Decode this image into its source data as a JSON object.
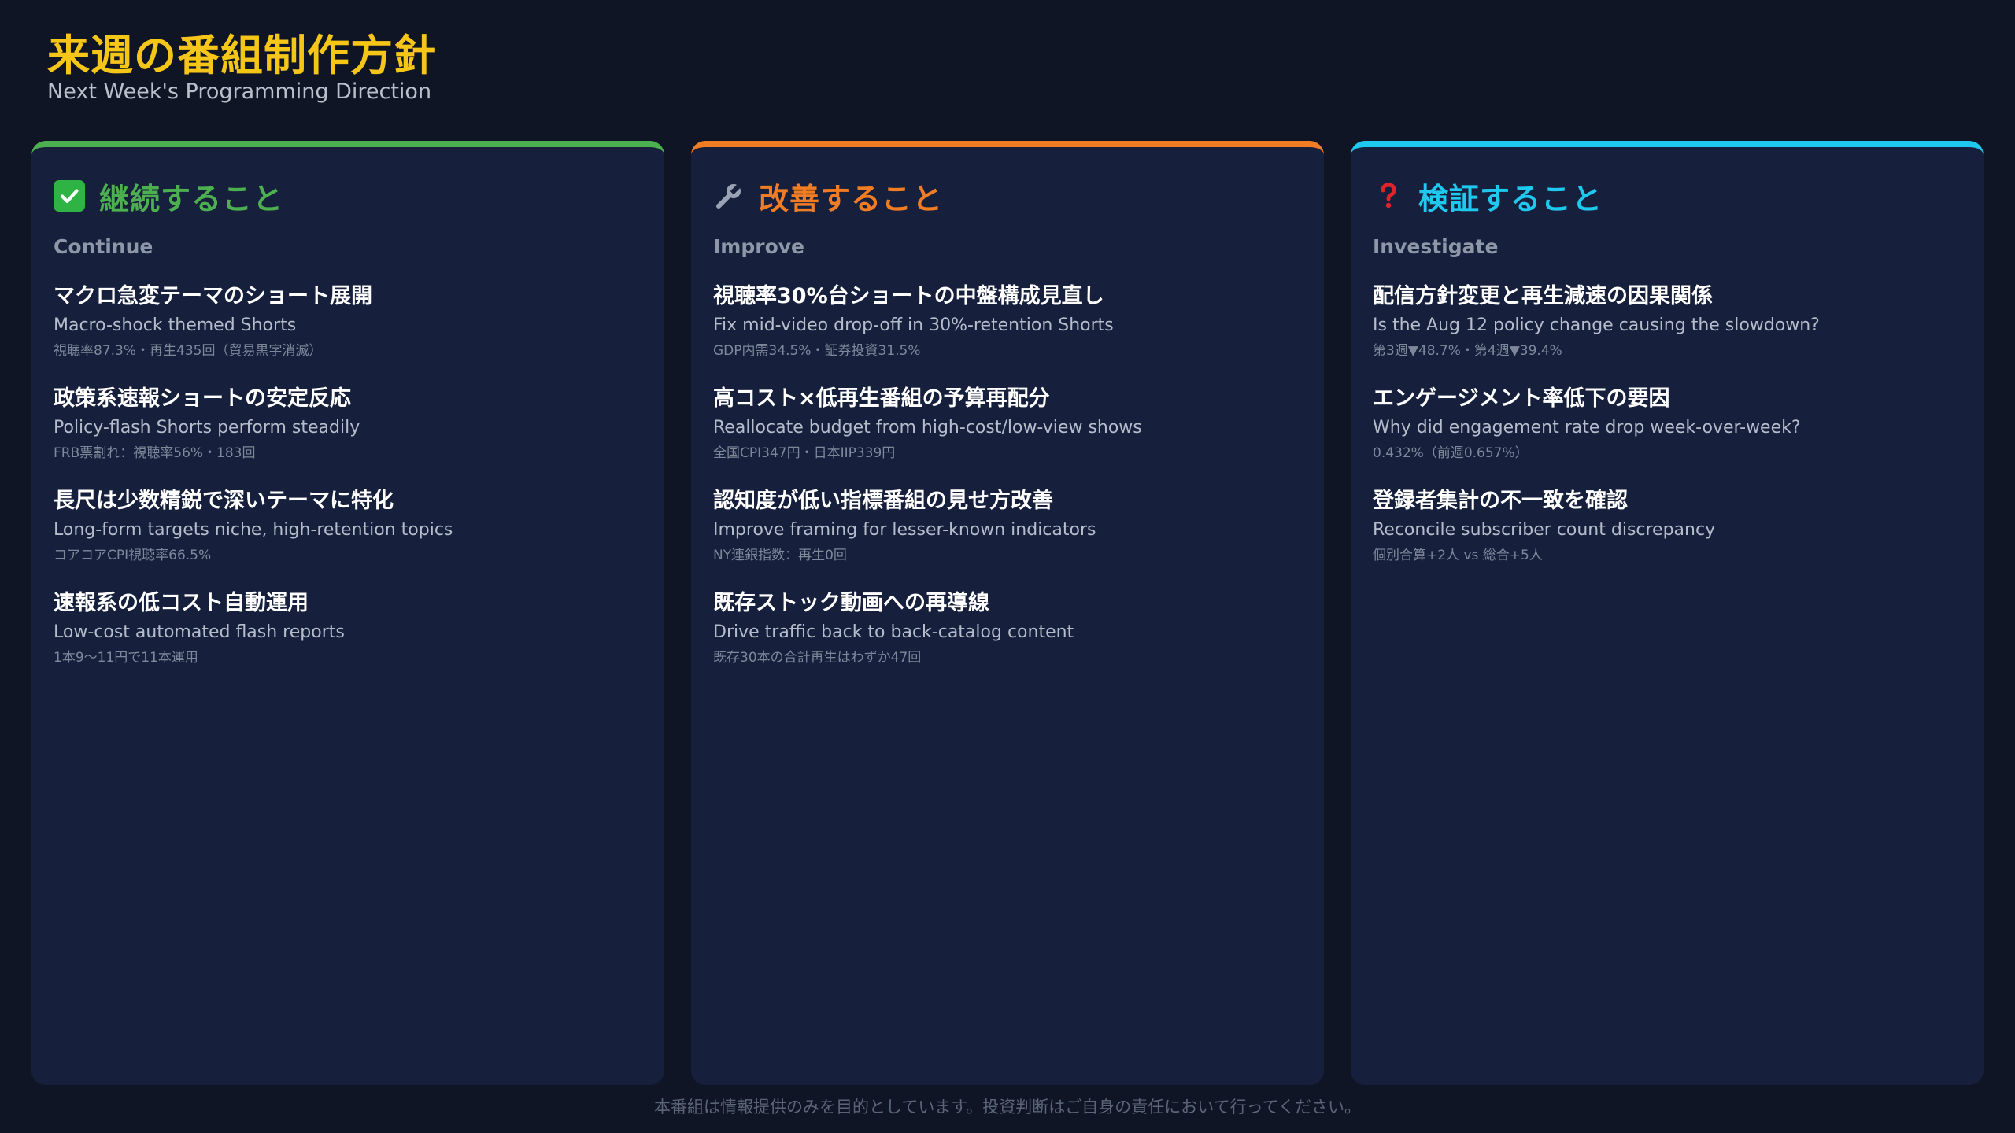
{
  "header": {
    "title": "来週の番組制作方針",
    "subtitle": "Next Week's Programming Direction"
  },
  "colors": {
    "title": "#f5c518",
    "continue": "#4caf50",
    "improve": "#f07c24",
    "investigate": "#1ec8ee",
    "card_bg": "#16203c",
    "page_bg": "#0f1524"
  },
  "columns": [
    {
      "icon": "check-icon",
      "title": "継続すること",
      "subtitle": "Continue",
      "items": [
        {
          "title": "マクロ急変テーマのショート展開",
          "en": "Macro-shock themed Shorts",
          "note": "視聴率87.3%・再生435回（貿易黒字消滅）"
        },
        {
          "title": "政策系速報ショートの安定反応",
          "en": "Policy-flash Shorts perform steadily",
          "note": "FRB票割れ：視聴率56%・183回"
        },
        {
          "title": "長尺は少数精鋭で深いテーマに特化",
          "en": "Long-form targets niche, high-retention topics",
          "note": "コアコアCPI視聴率66.5%"
        },
        {
          "title": "速報系の低コスト自動運用",
          "en": "Low-cost automated flash reports",
          "note": "1本9〜11円で11本運用"
        }
      ]
    },
    {
      "icon": "wrench-icon",
      "title": "改善すること",
      "subtitle": "Improve",
      "items": [
        {
          "title": "視聴率30%台ショートの中盤構成見直し",
          "en": "Fix mid-video drop-off in 30%-retention Shorts",
          "note": "GDP内需34.5%・証券投資31.5%"
        },
        {
          "title": "高コスト×低再生番組の予算再配分",
          "en": "Reallocate budget from high-cost/low-view shows",
          "note": "全国CPI347円・日本IIP339円"
        },
        {
          "title": "認知度が低い指標番組の見せ方改善",
          "en": "Improve framing for lesser-known indicators",
          "note": "NY連銀指数：再生0回"
        },
        {
          "title": "既存ストック動画への再導線",
          "en": "Drive traffic back to back-catalog content",
          "note": "既存30本の合計再生はわずか47回"
        }
      ]
    },
    {
      "icon": "question-icon",
      "title": "検証すること",
      "subtitle": "Investigate",
      "items": [
        {
          "title": "配信方針変更と再生減速の因果関係",
          "en": "Is the Aug 12 policy change causing the slowdown?",
          "note": "第3週▼48.7%・第4週▼39.4%"
        },
        {
          "title": "エンゲージメント率低下の要因",
          "en": "Why did engagement rate drop week-over-week?",
          "note": "0.432%（前週0.657%）"
        },
        {
          "title": "登録者集計の不一致を確認",
          "en": "Reconcile subscriber count discrepancy",
          "note": "個別合算+2人 vs 総合+5人"
        }
      ]
    }
  ],
  "footer": {
    "disclaimer": "本番組は情報提供のみを目的としています。投資判断はご自身の責任において行ってください。"
  }
}
